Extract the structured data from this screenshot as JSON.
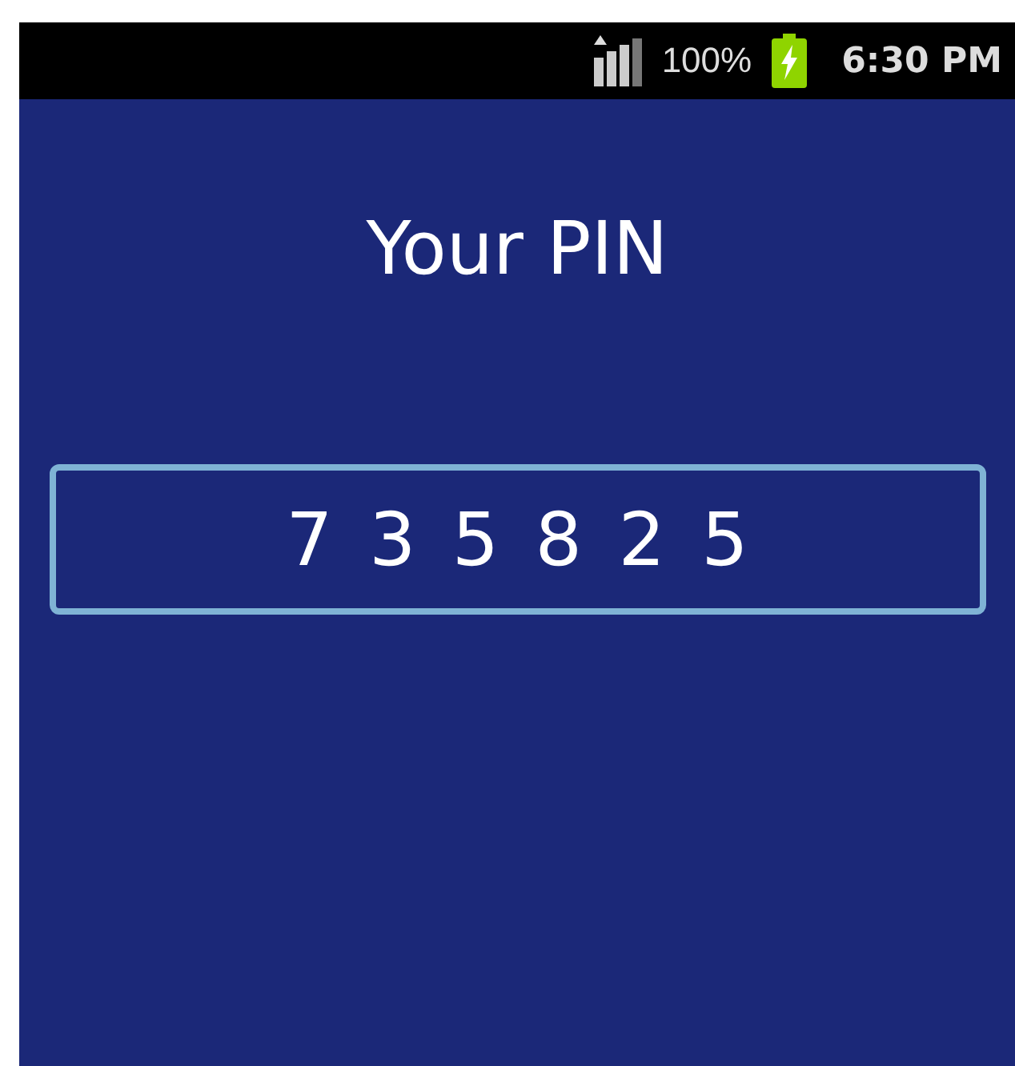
{
  "status_bar": {
    "battery_percent": "100%",
    "time": "6:30 PM"
  },
  "title": "Your PIN",
  "pin_field": {
    "value": "7 3 5 8 2 5"
  }
}
